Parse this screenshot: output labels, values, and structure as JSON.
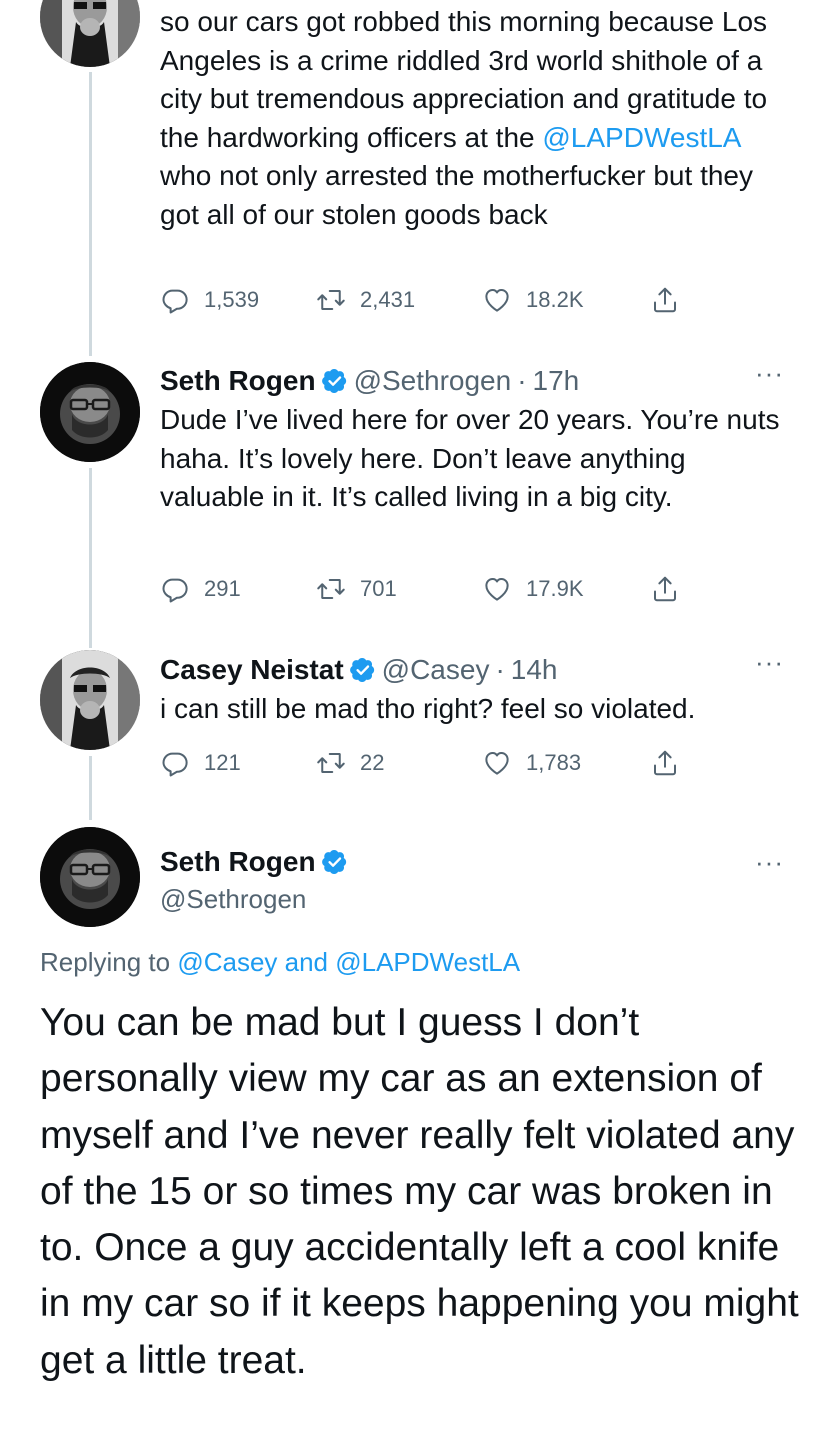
{
  "tweet1": {
    "text_pre": "so our cars got robbed this morning because Los Angeles is a crime riddled 3rd world shithole of a city but tremendous appreciation and gratitude to the hardworking officers at the ",
    "mention": "@LAPDWestLA",
    "text_post": " who not only arrested the motherfucker but they got all of our stolen goods back",
    "replies": "1,539",
    "retweets": "2,431",
    "likes": "18.2K"
  },
  "tweet2": {
    "name": "Seth Rogen",
    "handle": "@Sethrogen",
    "dot": "·",
    "time": "17h",
    "more": "···",
    "text": "Dude I’ve lived here for over 20 years. You’re nuts haha. It’s lovely here. Don’t leave anything valuable in it. It’s called living in a big city.",
    "replies": "291",
    "retweets": "701",
    "likes": "17.9K"
  },
  "tweet3": {
    "name": "Casey Neistat",
    "handle": "@Casey",
    "dot": "·",
    "time": "14h",
    "more": "···",
    "text": "i can still be mad tho right?  feel so violated.",
    "replies": "121",
    "retweets": "22",
    "likes": "1,783"
  },
  "main": {
    "name": "Seth Rogen",
    "handle": "@Sethrogen",
    "more": "···",
    "replying_prefix": "Replying to ",
    "replying_mention1": "@Casey",
    "replying_and": " and ",
    "replying_mention2": "@LAPDWestLA",
    "text": "You can be mad but I guess I don’t personally view my car as an extension of myself and I’ve never really felt violated any of the 15 or so times my car was broken in to. Once a guy accidentally left a cool knife in my car so if it keeps happening you might get a little treat."
  },
  "icons": {
    "reply": "reply-icon",
    "retweet": "retweet-icon",
    "like": "like-icon",
    "share": "share-icon",
    "verified": "verified-badge-icon"
  },
  "colors": {
    "link": "#1d9bf0",
    "secondary": "#536471",
    "thread_line": "#cfd9de",
    "verified": "#1d9bf0"
  }
}
